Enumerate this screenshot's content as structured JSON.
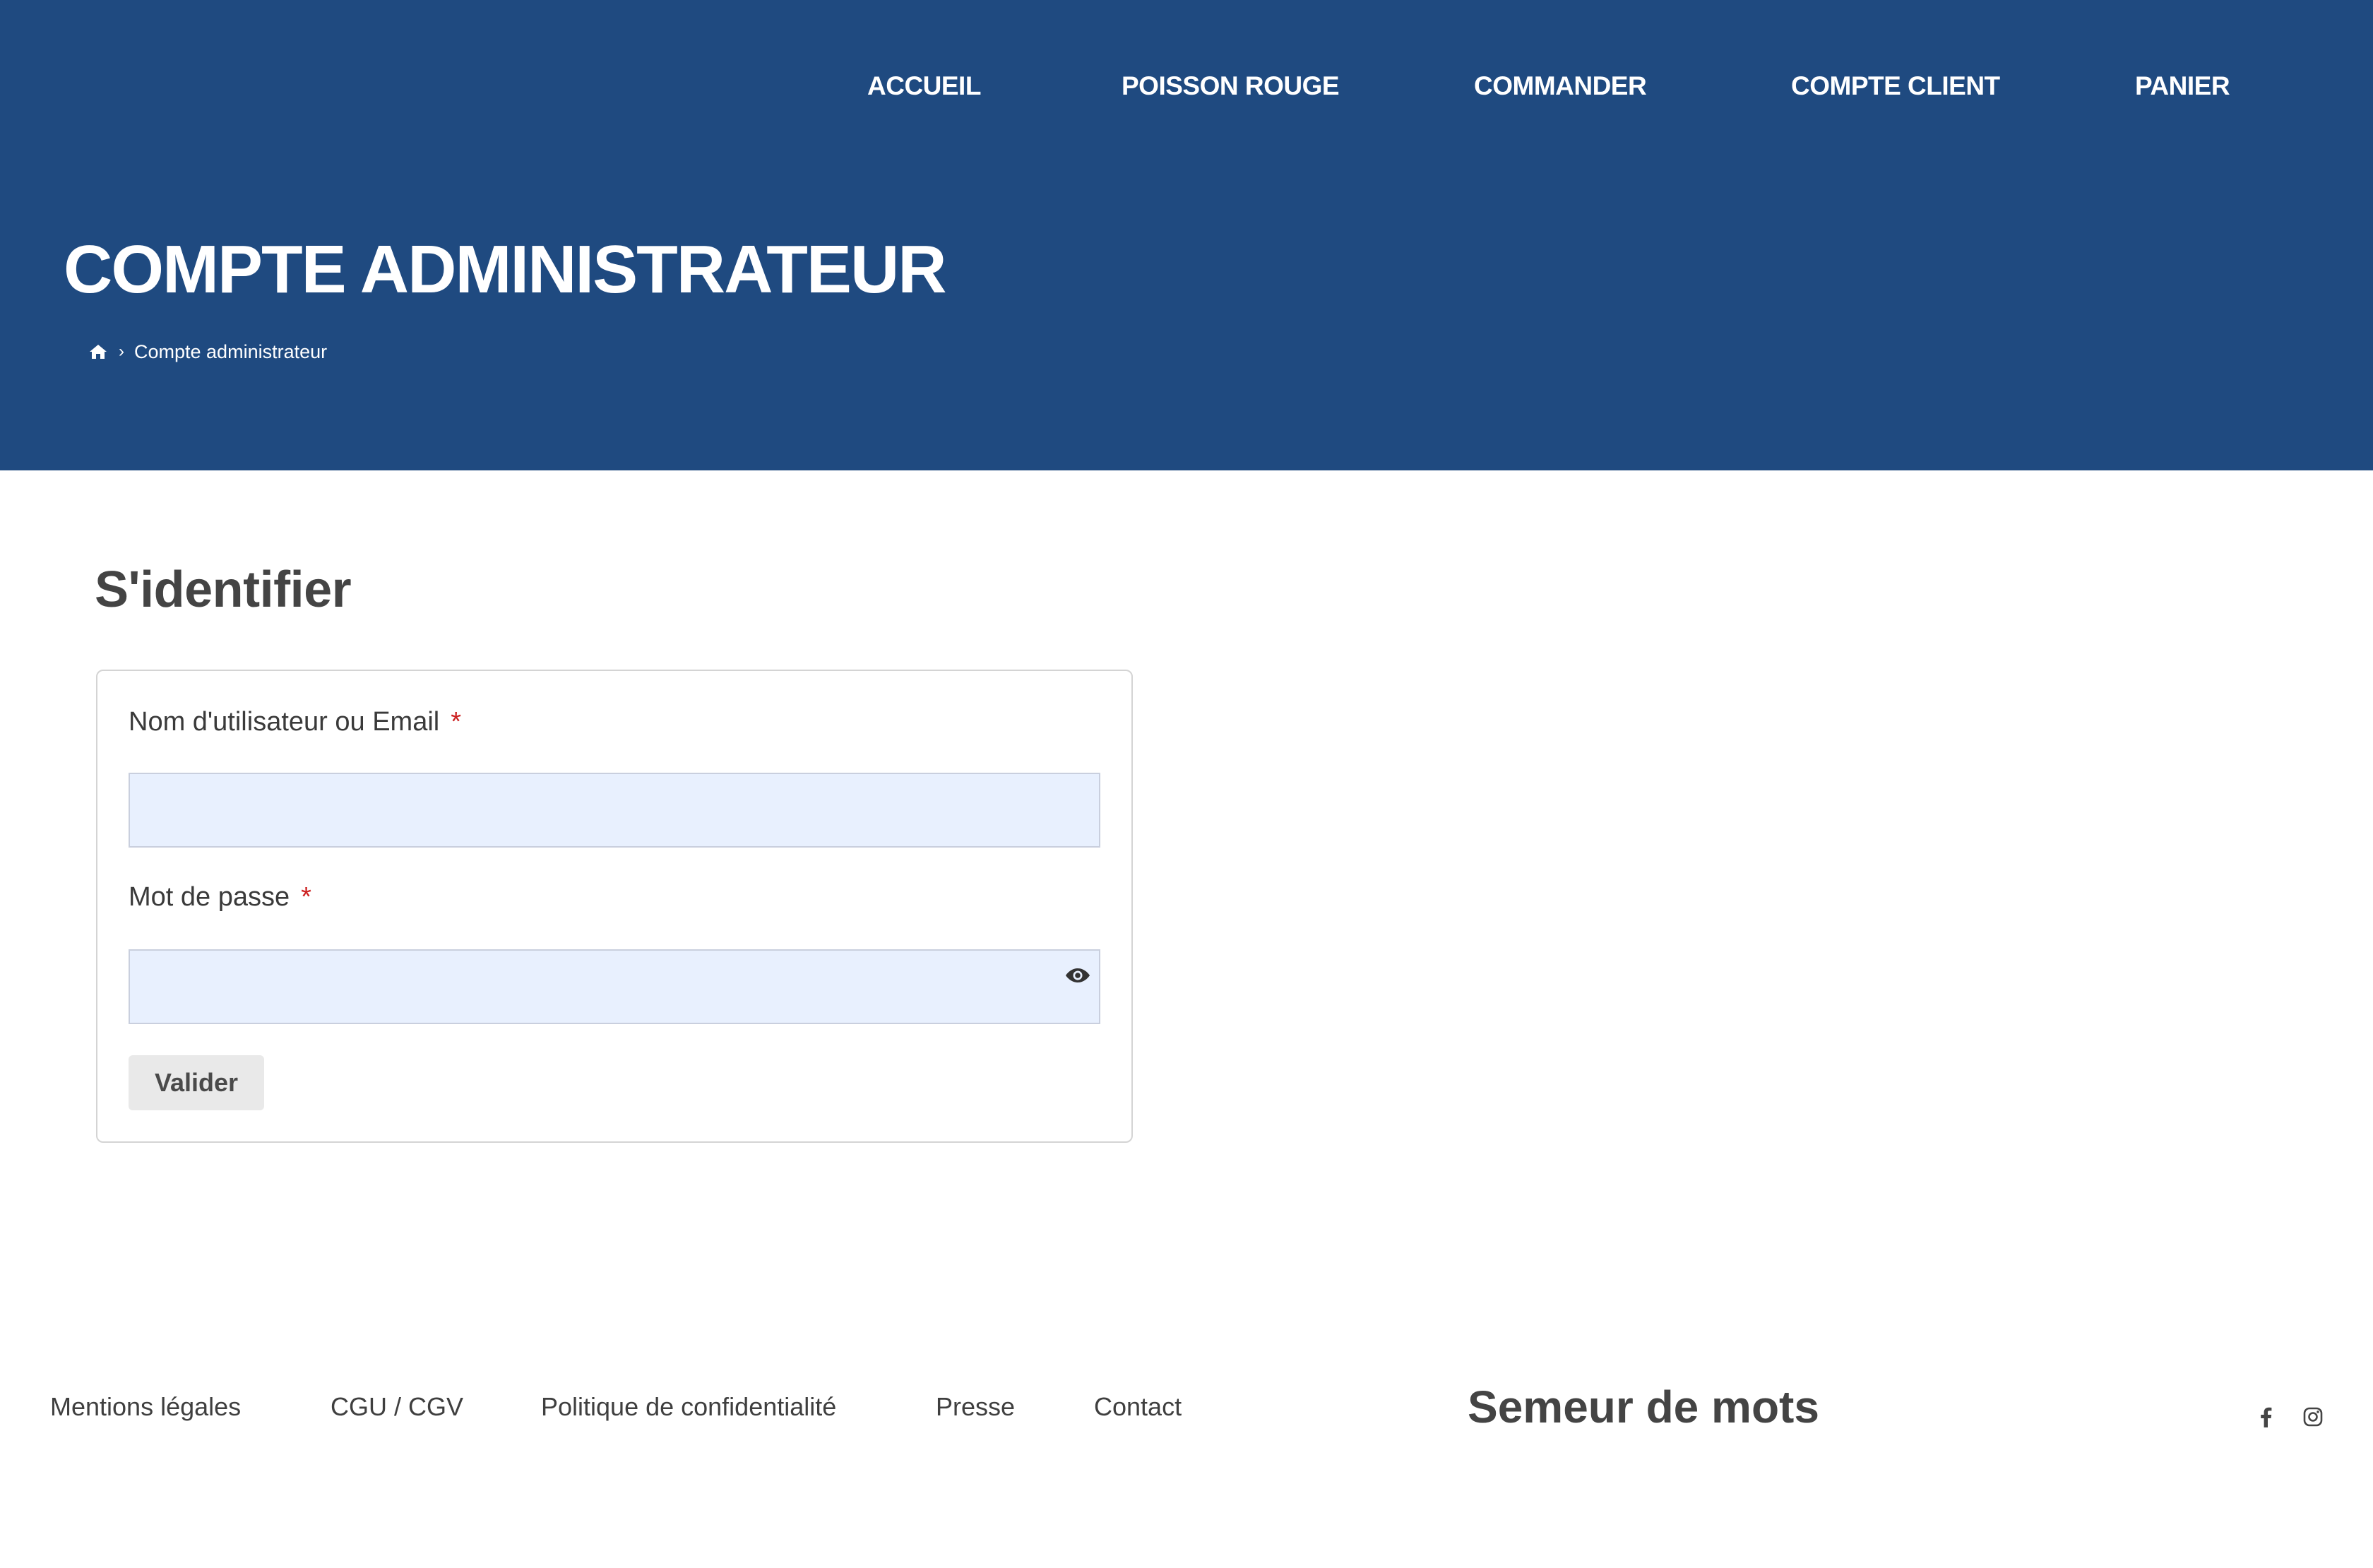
{
  "nav": {
    "items": [
      {
        "label": "ACCUEIL"
      },
      {
        "label": "POISSON ROUGE"
      },
      {
        "label": "COMMANDER"
      },
      {
        "label": "COMPTE CLIENT"
      },
      {
        "label": "PANIER"
      }
    ]
  },
  "header": {
    "title": "COMPTE ADMINISTRATEUR",
    "breadcrumb": {
      "home_icon": "home-icon",
      "separator": "›",
      "current": "Compte administrateur"
    }
  },
  "login": {
    "title": "S'identifier",
    "username_label": "Nom d'utilisateur ou Email",
    "username_value": "",
    "password_label": "Mot de passe",
    "password_value": "",
    "required_mark": "*",
    "show_password_icon": "eye-icon",
    "submit_label": "Valider"
  },
  "footer": {
    "links": [
      {
        "label": "Mentions légales"
      },
      {
        "label": "CGU / CGV"
      },
      {
        "label": "Politique de confidentialité"
      },
      {
        "label": "Presse"
      },
      {
        "label": "Contact"
      }
    ],
    "brand": "Semeur de mots",
    "social": [
      {
        "icon": "facebook-icon"
      },
      {
        "icon": "instagram-icon"
      }
    ]
  },
  "colors": {
    "header_bg": "#1f4a80",
    "input_bg": "#e8f0fe",
    "required": "#cc1f1f",
    "text": "#444444",
    "button_bg": "#e9e9e9"
  }
}
